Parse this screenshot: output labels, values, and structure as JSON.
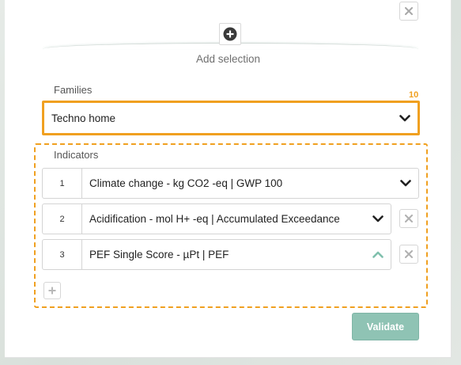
{
  "header": {
    "add_selection_label": "Add selection",
    "close_icon": "close-icon",
    "add_icon": "plus-circle-icon"
  },
  "families": {
    "label": "Families",
    "count": "10",
    "selected": "Techno home",
    "highlight_color": "#f0a020"
  },
  "indicators": {
    "label": "Indicators",
    "items": [
      {
        "index": "1",
        "text": "Climate change - kg CO2 -eq | GWP 100",
        "expanded": false,
        "removable": false
      },
      {
        "index": "2",
        "text": "Acidification - mol H+ -eq | Accumulated Exceedance",
        "expanded": false,
        "removable": true
      },
      {
        "index": "3",
        "text": "PEF Single Score - µPt | PEF",
        "expanded": true,
        "removable": true
      }
    ]
  },
  "footer": {
    "validate_label": "Validate",
    "validate_color": "#8fc3b4"
  }
}
